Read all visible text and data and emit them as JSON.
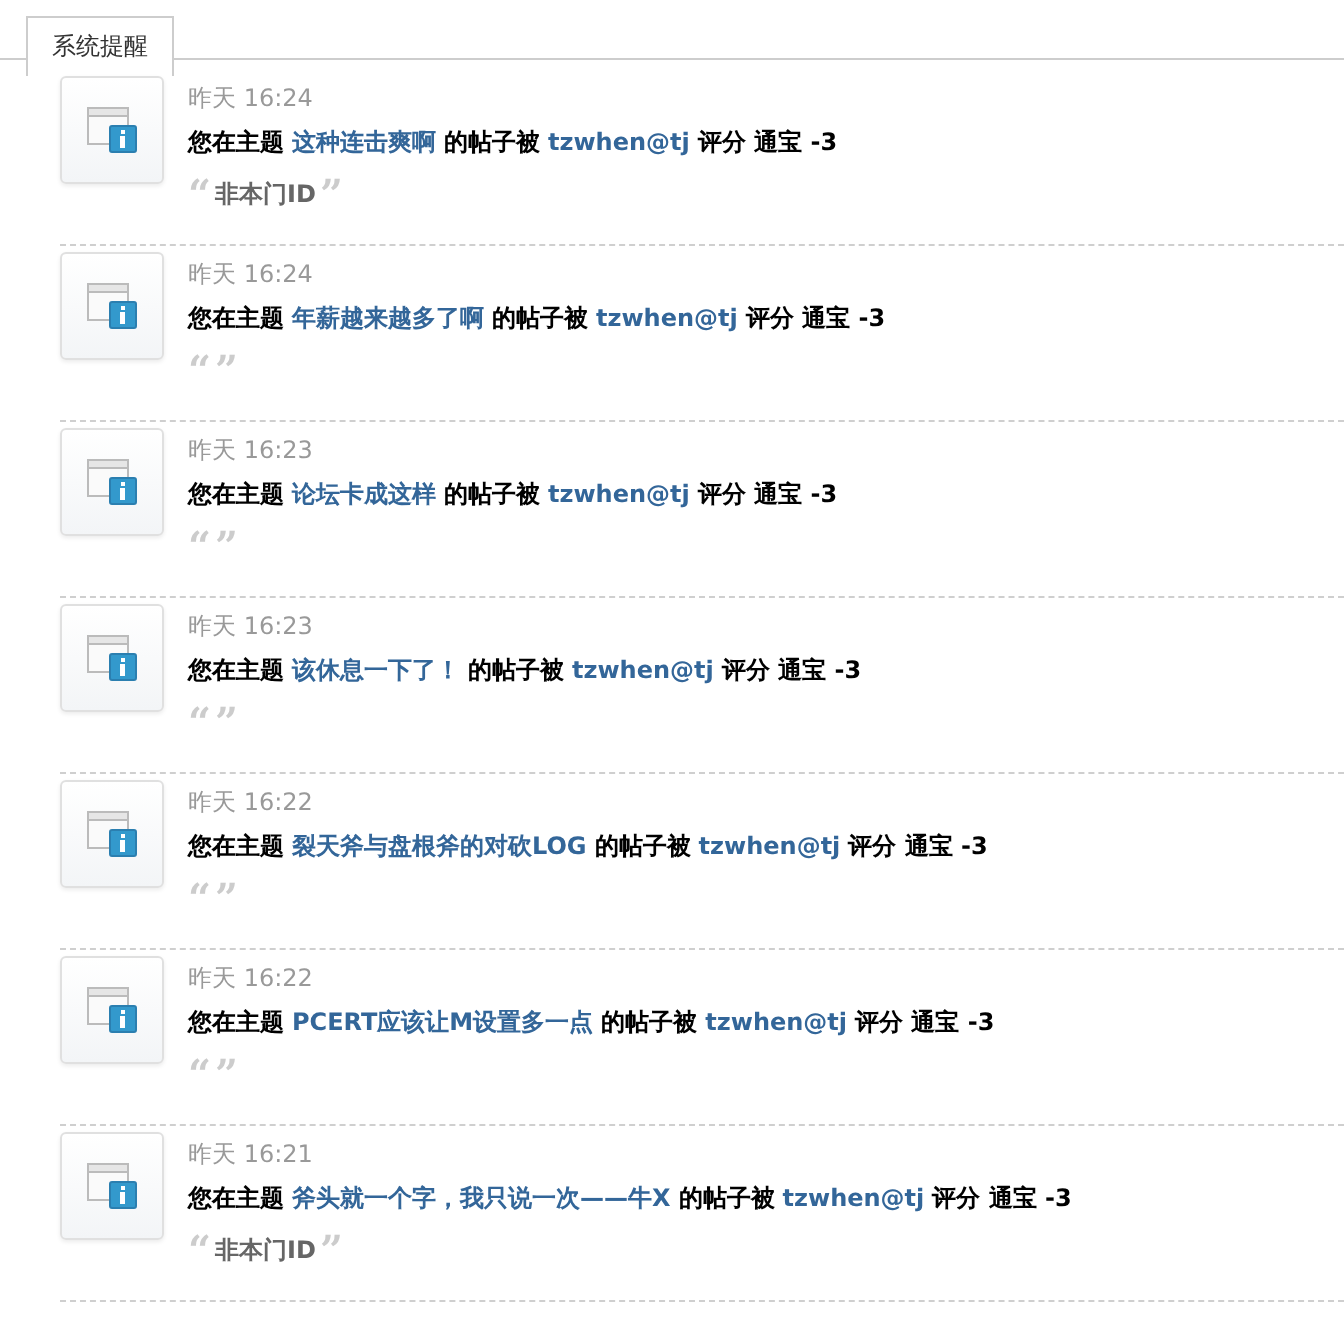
{
  "tabs": [
    {
      "label": "系统提醒",
      "selected": true
    }
  ],
  "notices": [
    {
      "time": "昨天 16:24",
      "prefix": "您在主题",
      "topic": "这种连击爽啊",
      "middle": "的帖子被",
      "user": "tzwhen@tj",
      "suffix": "评分 通宝 -3",
      "quote": {
        "open": "“",
        "reason": "非本门ID",
        "close": "”"
      }
    },
    {
      "time": "昨天 16:24",
      "prefix": "您在主题",
      "topic": "年薪越来越多了啊",
      "middle": "的帖子被",
      "user": "tzwhen@tj",
      "suffix": "评分 通宝 -3",
      "quote": {
        "open": "“",
        "close": "”"
      }
    },
    {
      "time": "昨天 16:23",
      "prefix": "您在主题",
      "topic": "论坛卡成这样",
      "middle": "的帖子被",
      "user": "tzwhen@tj",
      "suffix": "评分 通宝 -3",
      "quote": {
        "open": "“",
        "close": "”"
      }
    },
    {
      "time": "昨天 16:23",
      "prefix": "您在主题",
      "topic": "该休息一下了！",
      "middle": "的帖子被",
      "user": "tzwhen@tj",
      "suffix": "评分 通宝 -3",
      "quote": {
        "open": "“",
        "close": "”"
      }
    },
    {
      "time": "昨天 16:22",
      "prefix": "您在主题",
      "topic": "裂天斧与盘根斧的对砍LOG",
      "middle": "的帖子被",
      "user": "tzwhen@tj",
      "suffix": "评分 通宝 -3",
      "quote": {
        "open": "“",
        "close": "”"
      }
    },
    {
      "time": "昨天 16:22",
      "prefix": "您在主题",
      "topic": "PCERT应该让M设置多一点",
      "middle": "的帖子被",
      "user": "tzwhen@tj",
      "suffix": "评分 通宝 -3",
      "quote": {
        "open": "“",
        "close": "”"
      }
    },
    {
      "time": "昨天 16:21",
      "prefix": "您在主题",
      "topic": "斧头就一个字，我只说一次——牛X",
      "middle": "的帖子被",
      "user": "tzwhen@tj",
      "suffix": "评分 通宝 -3",
      "quote": {
        "open": "“",
        "reason": "非本门ID",
        "close": "”"
      }
    }
  ]
}
